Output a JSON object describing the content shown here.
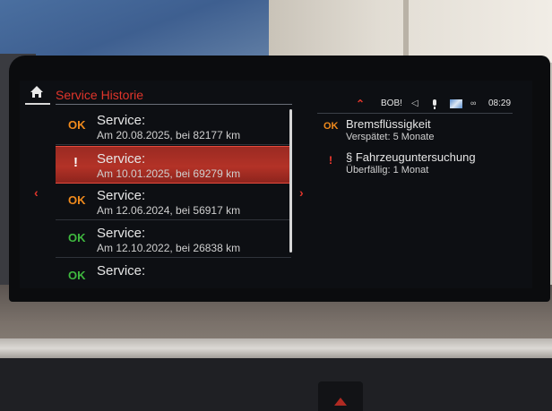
{
  "header": {
    "title": "Service Historie"
  },
  "status_bar": {
    "station": "BOB!",
    "time": "08:29"
  },
  "service_list": [
    {
      "status": "OK",
      "title": "Service:",
      "detail": "Am 20.08.2025, bei 82177 km"
    },
    {
      "status": "!",
      "title": "Service:",
      "detail": "Am 10.01.2025, bei 69279 km"
    },
    {
      "status": "OK",
      "title": "Service:",
      "detail": "Am 12.06.2024, bei 56917 km"
    },
    {
      "status": "OK",
      "title": "Service:",
      "detail": "Am 12.10.2022, bei 26838 km"
    },
    {
      "status": "OK",
      "title": "Service:",
      "detail": ""
    }
  ],
  "detail_panel": [
    {
      "status": "OK",
      "title": "Bremsflüssigkeit",
      "subtitle": "Verspätet: 5 Monate"
    },
    {
      "status": "!",
      "title": "§ Fahrzeuguntersuchung",
      "subtitle": "Überfällig: 1 Monat"
    }
  ],
  "colors": {
    "accent_red": "#e0352b",
    "ok_orange": "#f08a1c",
    "ok_green": "#3fb83f",
    "selected_row": "#b33227"
  },
  "icons": {
    "home": "home-icon",
    "nav_left": "chevron-left-icon",
    "nav_right": "chevron-right-icon",
    "status_chevron": "chevron-up-icon",
    "audio": "speaker-icon",
    "mic": "microphone-icon",
    "navigation": "map-icon",
    "connected_drive": "connected-drive-icon"
  }
}
